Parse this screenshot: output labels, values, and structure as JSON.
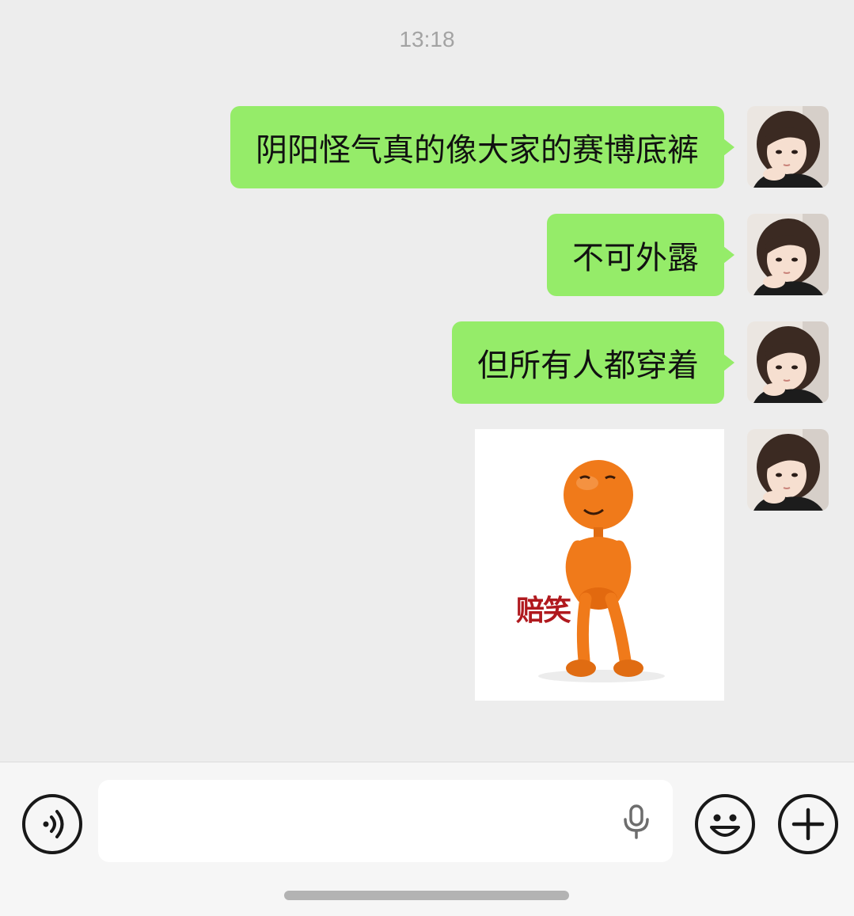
{
  "chat": {
    "timestamp": "13:18",
    "messages": [
      {
        "sender": "me",
        "type": "text",
        "text": "阴阳怪气真的像大家的赛博底裤"
      },
      {
        "sender": "me",
        "type": "text",
        "text": "不可外露"
      },
      {
        "sender": "me",
        "type": "text",
        "text": "但所有人都穿着"
      },
      {
        "sender": "me",
        "type": "sticker",
        "caption": "赔笑"
      }
    ]
  },
  "input_bar": {
    "voice_icon": "voice-mode-icon",
    "mic_icon": "microphone-icon",
    "emoji_icon": "emoji-icon",
    "more_icon": "plus-icon",
    "input_value": ""
  },
  "colors": {
    "background": "#ededed",
    "bubble_green": "#95ec69",
    "timestamp_gray": "#a3a3a3",
    "sticker_figure_orange": "#f07a1a",
    "sticker_caption_red": "#b0191e"
  }
}
